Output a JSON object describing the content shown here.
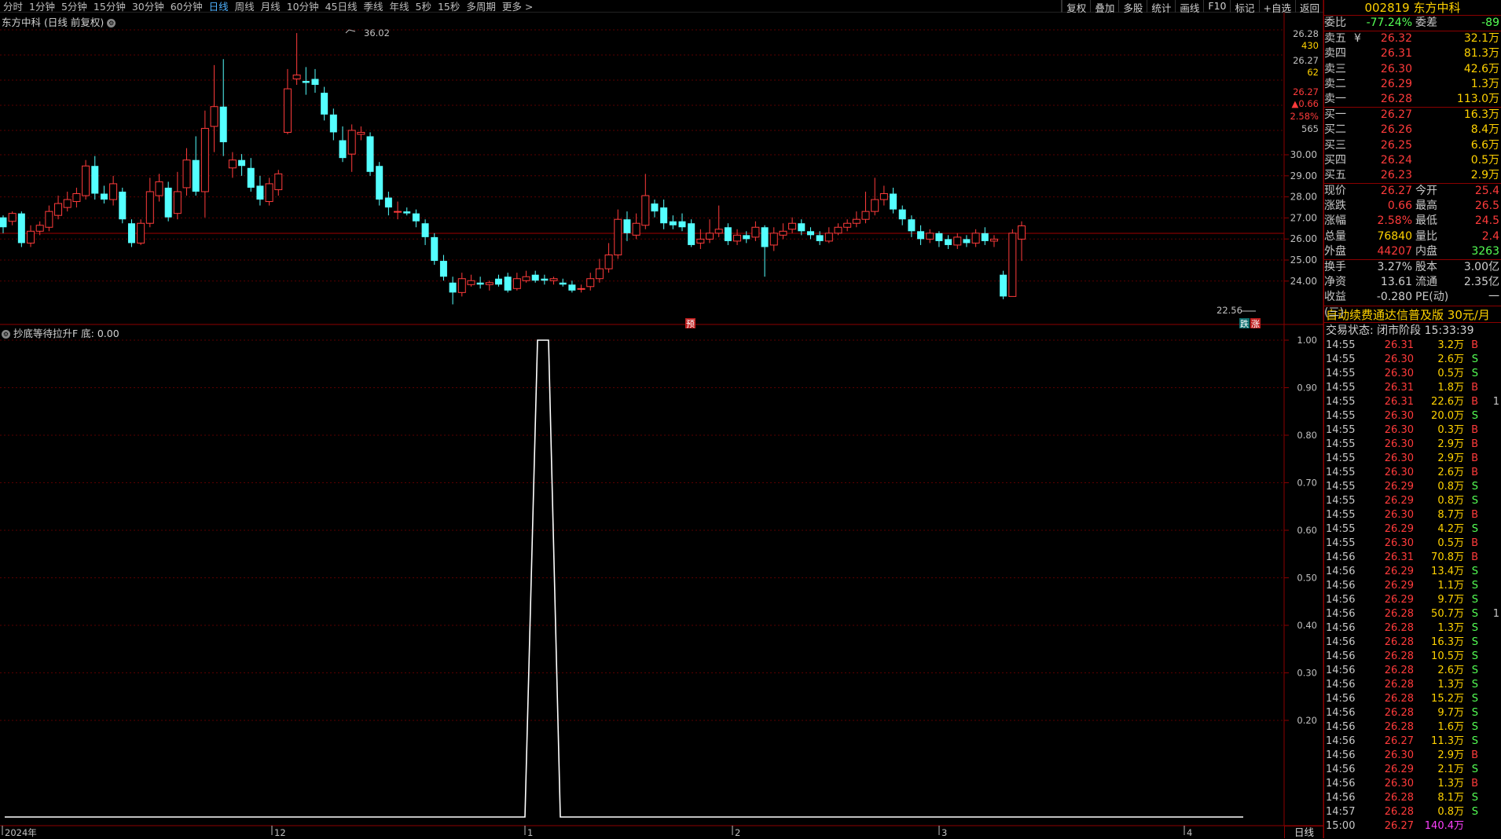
{
  "toolbar": {
    "timeframes": [
      "分时",
      "1分钟",
      "5分钟",
      "15分钟",
      "30分钟",
      "60分钟",
      "日线",
      "周线",
      "月线",
      "10分钟",
      "45日线",
      "季线",
      "年线",
      "5秒",
      "15秒",
      "多周期",
      "更多 >"
    ],
    "active": "日线",
    "right_buttons": [
      "复权",
      "叠加",
      "多股",
      "统计",
      "画线",
      "F10",
      "标记",
      "+自选",
      "返回"
    ]
  },
  "chart": {
    "title": "东方中科 (日线 前复权)",
    "high_label": "36.02",
    "low_label": "22.56",
    "badge_yu": "预",
    "badge_die": "跌",
    "badge_zhang": "涨",
    "price_axis": [
      "30.00",
      "29.00",
      "28.00",
      "27.00",
      "26.00",
      "25.00",
      "24.00"
    ],
    "price_info": [
      "26.28",
      "430",
      "26.27",
      "62",
      "26.27",
      "▲0.66",
      "2.58%",
      "565"
    ],
    "x_labels": [
      "2024年",
      "12",
      "1",
      "2",
      "3",
      "4"
    ],
    "current_price": 26.27,
    "colors": {
      "up": "#ff3b3b",
      "down": "#54ffff",
      "grid": "#5a0000",
      "axis": "#8b0000",
      "indicator": "#ffffff"
    }
  },
  "indicator": {
    "title": "抄底等待拉升F 底: 0.00",
    "axis": [
      "1.00",
      "0.90",
      "0.80",
      "0.70",
      "0.60",
      "0.50",
      "0.40",
      "0.30",
      "0.20"
    ]
  },
  "bottom_tab": "日线",
  "panel": {
    "code": "002819",
    "name": "东方中科",
    "weibi_label": "委比",
    "weibi": "-77.24%",
    "weicha_label": "委差",
    "weicha": "-89",
    "asks": [
      {
        "label": "卖五",
        "cur": "¥",
        "price": "26.32",
        "vol": "32.1万"
      },
      {
        "label": "卖四",
        "cur": "",
        "price": "26.31",
        "vol": "81.3万"
      },
      {
        "label": "卖三",
        "cur": "",
        "price": "26.30",
        "vol": "42.6万"
      },
      {
        "label": "卖二",
        "cur": "",
        "price": "26.29",
        "vol": "1.3万"
      },
      {
        "label": "卖一",
        "cur": "",
        "price": "26.28",
        "vol": "113.0万"
      }
    ],
    "bids": [
      {
        "label": "买一",
        "price": "26.27",
        "vol": "16.3万"
      },
      {
        "label": "买二",
        "price": "26.26",
        "vol": "8.4万"
      },
      {
        "label": "买三",
        "price": "26.25",
        "vol": "6.6万"
      },
      {
        "label": "买四",
        "price": "26.24",
        "vol": "0.5万"
      },
      {
        "label": "买五",
        "price": "26.23",
        "vol": "2.9万"
      }
    ],
    "stats": [
      {
        "l1": "现价",
        "v1": "26.27",
        "l2": "今开",
        "v2": "25.4"
      },
      {
        "l1": "涨跌",
        "v1": "0.66",
        "l2": "最高",
        "v2": "26.5"
      },
      {
        "l1": "涨幅",
        "v1": "2.58%",
        "l2": "最低",
        "v2": "24.5"
      },
      {
        "l1": "总量",
        "v1": "76840",
        "l2": "量比",
        "v2": "2.4"
      },
      {
        "l1": "外盘",
        "v1": "44207",
        "l2": "内盘",
        "v2": "3263"
      }
    ],
    "stats2": [
      {
        "l1": "换手",
        "v1": "3.27%",
        "l2": "股本",
        "v2": "3.00亿"
      },
      {
        "l1": "净资",
        "v1": "13.61",
        "l2": "流通",
        "v2": "2.35亿"
      },
      {
        "l1": "收益(三)",
        "v1": "-0.280",
        "l2": "PE(动)",
        "v2": "一"
      }
    ],
    "promo": "自动续费通达信普及版 30元/月",
    "status": "交易状态: 闭市阶段 15:33:39",
    "ticks": [
      [
        "14:55",
        "26.31",
        "3.2万",
        "B",
        ""
      ],
      [
        "14:55",
        "26.30",
        "2.6万",
        "S",
        ""
      ],
      [
        "14:55",
        "26.30",
        "0.5万",
        "S",
        ""
      ],
      [
        "14:55",
        "26.31",
        "1.8万",
        "B",
        ""
      ],
      [
        "14:55",
        "26.31",
        "22.6万",
        "B",
        "1"
      ],
      [
        "14:55",
        "26.30",
        "20.0万",
        "S",
        ""
      ],
      [
        "14:55",
        "26.30",
        "0.3万",
        "B",
        ""
      ],
      [
        "14:55",
        "26.30",
        "2.9万",
        "B",
        ""
      ],
      [
        "14:55",
        "26.30",
        "2.9万",
        "B",
        ""
      ],
      [
        "14:55",
        "26.30",
        "2.6万",
        "B",
        ""
      ],
      [
        "14:55",
        "26.29",
        "0.8万",
        "S",
        ""
      ],
      [
        "14:55",
        "26.29",
        "0.8万",
        "S",
        ""
      ],
      [
        "14:55",
        "26.30",
        "8.7万",
        "B",
        ""
      ],
      [
        "14:55",
        "26.29",
        "4.2万",
        "S",
        ""
      ],
      [
        "14:55",
        "26.30",
        "0.5万",
        "B",
        ""
      ],
      [
        "14:56",
        "26.31",
        "70.8万",
        "B",
        ""
      ],
      [
        "14:56",
        "26.29",
        "13.4万",
        "S",
        ""
      ],
      [
        "14:56",
        "26.29",
        "1.1万",
        "S",
        ""
      ],
      [
        "14:56",
        "26.29",
        "9.7万",
        "S",
        ""
      ],
      [
        "14:56",
        "26.28",
        "50.7万",
        "S",
        "1"
      ],
      [
        "14:56",
        "26.28",
        "1.3万",
        "S",
        ""
      ],
      [
        "14:56",
        "26.28",
        "16.3万",
        "S",
        ""
      ],
      [
        "14:56",
        "26.28",
        "10.5万",
        "S",
        ""
      ],
      [
        "14:56",
        "26.28",
        "2.6万",
        "S",
        ""
      ],
      [
        "14:56",
        "26.28",
        "1.3万",
        "S",
        ""
      ],
      [
        "14:56",
        "26.28",
        "15.2万",
        "S",
        ""
      ],
      [
        "14:56",
        "26.28",
        "9.7万",
        "S",
        ""
      ],
      [
        "14:56",
        "26.28",
        "1.6万",
        "S",
        ""
      ],
      [
        "14:56",
        "26.27",
        "11.3万",
        "S",
        ""
      ],
      [
        "14:56",
        "26.30",
        "2.9万",
        "B",
        ""
      ],
      [
        "14:56",
        "26.29",
        "2.1万",
        "S",
        ""
      ],
      [
        "14:56",
        "26.30",
        "1.3万",
        "B",
        ""
      ],
      [
        "14:56",
        "26.28",
        "8.1万",
        "S",
        ""
      ],
      [
        "14:57",
        "26.28",
        "0.8万",
        "S",
        ""
      ],
      [
        "15:00",
        "26.27",
        "140.4万",
        "",
        ""
      ]
    ]
  }
}
